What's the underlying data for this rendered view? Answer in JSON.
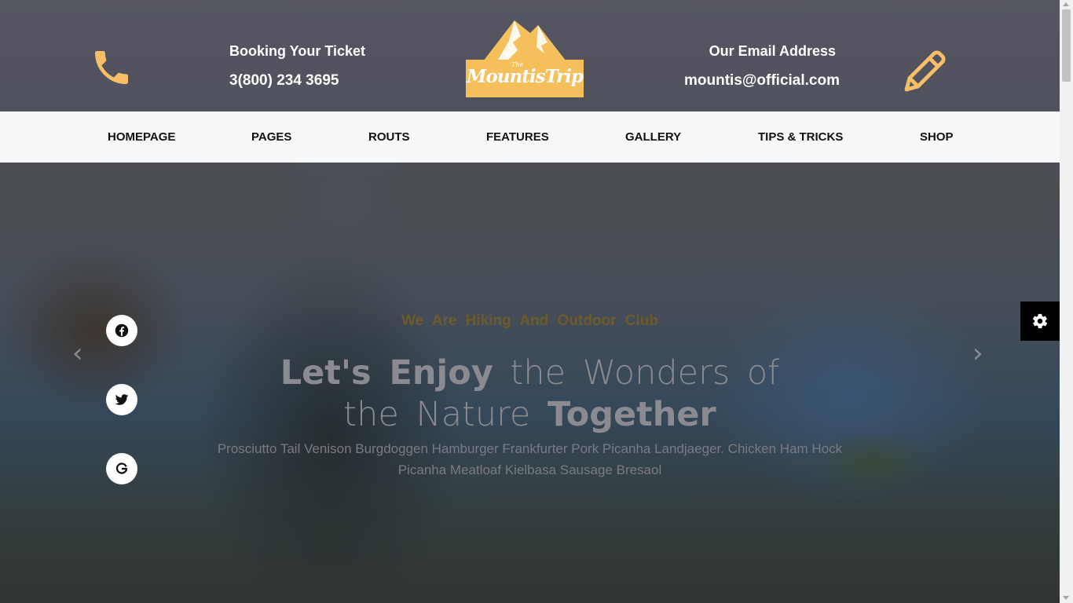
{
  "header": {
    "booking_title": "Booking Your Ticket",
    "booking_phone": "3(800) 234 3695",
    "email_title": "Our Email Address",
    "email_value": "mountis@official.com",
    "logo_small": "The",
    "logo_text": "MountisTrip",
    "icons": {
      "phone": "phone-icon",
      "pencil": "pencil-icon"
    },
    "accent_color": "#f5bf5c"
  },
  "nav": {
    "items": [
      {
        "label": "HOMEPAGE"
      },
      {
        "label": "PAGES"
      },
      {
        "label": "ROUTS"
      },
      {
        "label": "FEATURES"
      },
      {
        "label": "GALLERY"
      },
      {
        "label": "TIPS & TRICKS"
      },
      {
        "label": "SHOP"
      }
    ]
  },
  "hero": {
    "subtitle": "We Are Hiking And Outdoor Club",
    "title_line1_bold": "Let's Enjoy",
    "title_line1_rest": "the Wonders of",
    "title_line2_light": "the Nature",
    "title_line2_bold": "Together",
    "desc_line1": "Prosciutto Tail Venison Burgdoggen Hamburger Frankfurter Pork Picanha Landjaeger. Chicken Ham Hock",
    "desc_line2": "Picanha Meatloaf Kielbasa Sausage Bresaol",
    "arrow_left": "‹",
    "arrow_right": "›"
  },
  "social": [
    {
      "icon": "facebook-icon"
    },
    {
      "icon": "twitter-icon"
    },
    {
      "icon": "google-icon"
    }
  ],
  "settings": {
    "icon": "gear-icon"
  }
}
